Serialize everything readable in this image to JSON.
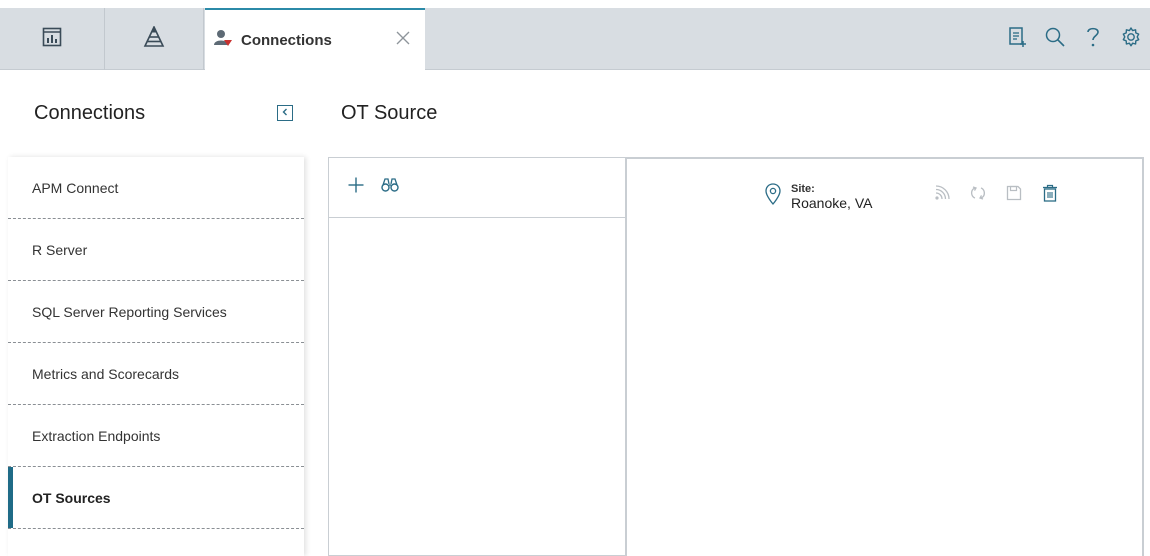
{
  "header": {
    "active_tab": {
      "label": "Connections",
      "icon": "user-alert-icon"
    },
    "home_tabs": [
      {
        "icon": "dashboard-icon"
      },
      {
        "icon": "pyramid-icon"
      }
    ],
    "actions": [
      {
        "icon": "add-document-icon"
      },
      {
        "icon": "search-icon"
      },
      {
        "icon": "help-icon"
      },
      {
        "icon": "gear-icon"
      }
    ]
  },
  "sidebar": {
    "title": "Connections",
    "items": [
      {
        "label": "APM Connect"
      },
      {
        "label": "R Server"
      },
      {
        "label": "SQL Server Reporting Services"
      },
      {
        "label": "Metrics and Scorecards"
      },
      {
        "label": "Extraction Endpoints"
      },
      {
        "label": "OT Sources",
        "active": true
      }
    ]
  },
  "main": {
    "title": "OT Source",
    "toolbar": [
      {
        "icon": "plus-icon"
      },
      {
        "icon": "binoculars-icon"
      }
    ],
    "detail": {
      "site_label": "Site:",
      "site_value": "Roanoke, VA",
      "actions": [
        {
          "icon": "signal-icon"
        },
        {
          "icon": "refresh-icon"
        },
        {
          "icon": "save-icon"
        },
        {
          "icon": "trash-icon"
        }
      ]
    }
  },
  "colors": {
    "accent": "#1f6b87",
    "tab_top": "#2b8aa8",
    "topbar_bg": "#d8dde2",
    "icon_muted": "#b9bec3",
    "icon_blue": "#2b6c86"
  }
}
